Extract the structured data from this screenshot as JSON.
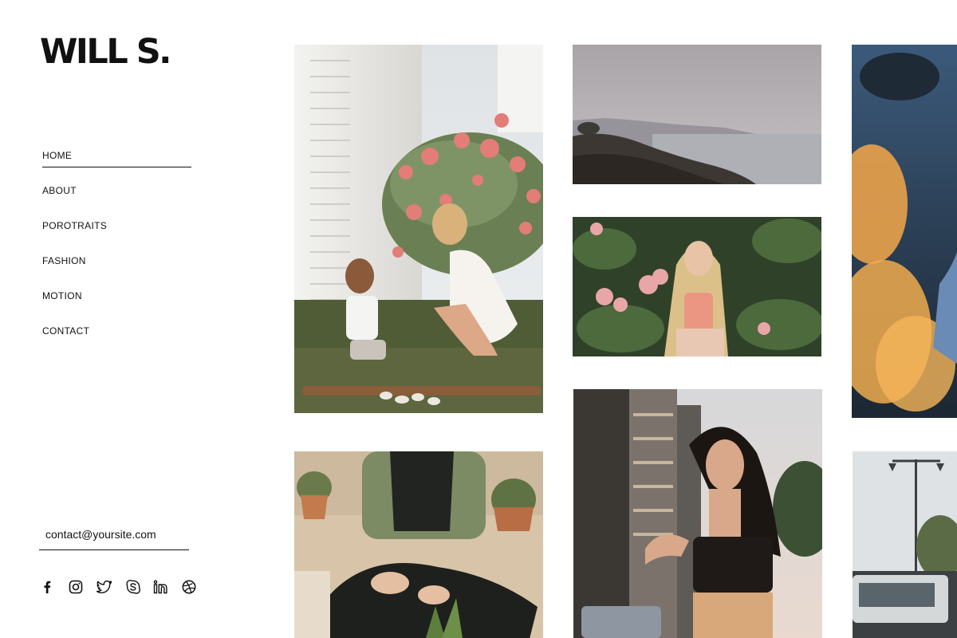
{
  "brand": {
    "logo_text": "WILL S."
  },
  "nav": {
    "items": [
      {
        "label": "HOME",
        "active": true
      },
      {
        "label": "ABOUT"
      },
      {
        "label": "POROTRAITS"
      },
      {
        "label": "FASHION"
      },
      {
        "label": "MOTION"
      },
      {
        "label": "CONTACT"
      }
    ]
  },
  "contact": {
    "email": "contact@yoursite.com"
  },
  "social": {
    "icons": [
      "facebook-icon",
      "instagram-icon",
      "twitter-icon",
      "skype-icon",
      "linkedin-icon",
      "dribbble-icon"
    ]
  },
  "gallery": {
    "photos": [
      {
        "name": "photo-garden-mother-child",
        "subject": "mother and child crouching by flowering bush"
      },
      {
        "name": "photo-foggy-coastline",
        "subject": "foggy rocky coastline"
      },
      {
        "name": "photo-blonde-flowers",
        "subject": "blonde woman in front of pink flowers"
      },
      {
        "name": "photo-woman-city",
        "subject": "woman with long dark hair among city buildings"
      },
      {
        "name": "photo-plants-overalls",
        "subject": "person in overalls sitting among potted plants"
      },
      {
        "name": "photo-bokeh-lights",
        "subject": "orange bokeh lights"
      },
      {
        "name": "photo-street-lamp",
        "subject": "street lamp and vehicle"
      }
    ]
  },
  "colors": {
    "text": "#111111",
    "background": "#ffffff"
  }
}
